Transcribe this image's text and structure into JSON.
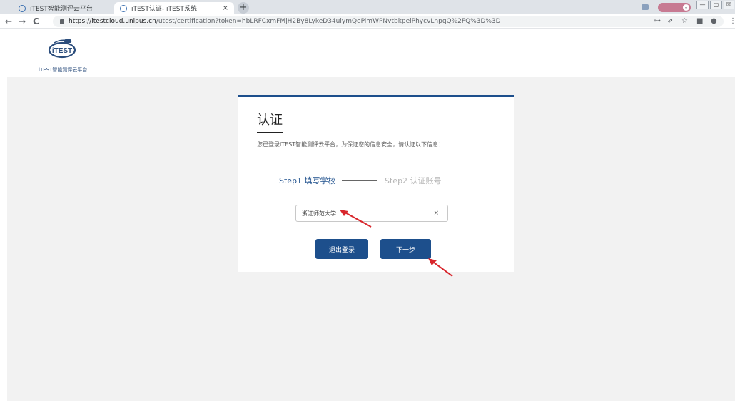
{
  "browser": {
    "tabs": [
      {
        "title": "iTEST智能测评云平台",
        "close": "×"
      },
      {
        "title": "iTEST认证- iTEST系统",
        "close": "×"
      }
    ],
    "new_tab": "+",
    "back": "←",
    "forward": "→",
    "reload": "C",
    "url_host": "https://itestcloud.unipus.cn",
    "url_path": "/utest/certification?token=hbLRFCxmFMjH2By8LykeD34uiymQePimWPNvtbkpelPhycvLnpqQ%2FQ%3D%3D",
    "window_controls": {
      "minimize": "—",
      "maximize": "▢",
      "close": "☒"
    },
    "icons": [
      "key-icon",
      "share-icon",
      "star-icon",
      "sidepanel-icon",
      "profile-icon",
      "menu-icon"
    ]
  },
  "site": {
    "logo_text": "iTEST智能测评云平台",
    "logo_mark_text": "iTEST"
  },
  "card": {
    "title": "认证",
    "description": "您已登录iTEST智能测评云平台，为保证您的信息安全，请认证以下信息：",
    "step1": "Step1 填写学校",
    "step2": "Step2 认证账号",
    "school_value": "浙江师范大学",
    "clear": "×",
    "logout_label": "退出登录",
    "next_label": "下一步"
  },
  "colors": {
    "primary": "#1d4f8c",
    "background": "#f2f2f2",
    "annotation_arrow": "#d8262c"
  }
}
